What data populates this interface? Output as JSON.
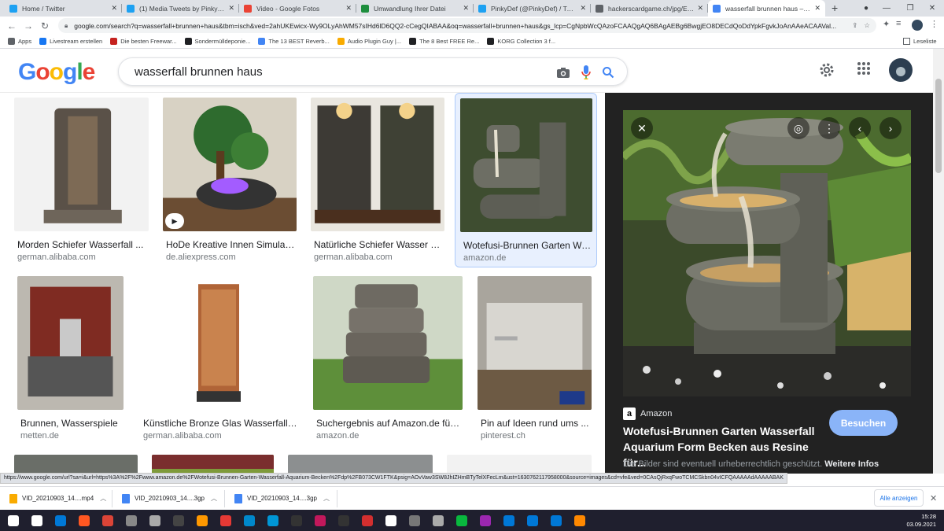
{
  "browser": {
    "tabs": [
      {
        "title": "Home / Twitter",
        "favicon_color": "#1da1f2",
        "active": false
      },
      {
        "title": "(1) Media Tweets by PinkyDef (@",
        "favicon_color": "#1da1f2",
        "active": false
      },
      {
        "title": "Video - Google Fotos",
        "favicon_color": "#ea4335",
        "active": false
      },
      {
        "title": "Umwandlung Ihrer Datei",
        "favicon_color": "#1e8e3e",
        "active": false
      },
      {
        "title": "PinkyDef (@PinkyDef) / Twitter",
        "favicon_color": "#1da1f2",
        "active": false
      },
      {
        "title": "hackerscardgame.ch/jpg/EN/#a",
        "favicon_color": "#5f6368",
        "active": false
      },
      {
        "title": "wasserfall brunnen haus – Goog",
        "favicon_color": "#4285f4",
        "active": true
      }
    ],
    "new_tab_symbol": "+",
    "url": "google.com/search?q=wasserfall+brunnen+haus&tbm=isch&ved=2ahUKEwicx-Wy9OLyAhWM57sIHd6lD6QQ2-cCegQIABAA&oq=wasserfall+brunnen+haus&gs_lcp=CgNpbWcQAzoFCAAQgAQ6BAgAEBg6BwgjEO8DECdQoDdYpkFgvkJoAnAAeACAAVal...",
    "bookmarks": [
      {
        "label": "Apps",
        "color": "#5f6368"
      },
      {
        "label": "Livestream erstellen",
        "color": "#1877f2"
      },
      {
        "label": "Die besten Freewar...",
        "color": "#c5221f"
      },
      {
        "label": "Sondermülldeponie...",
        "color": "#202124"
      },
      {
        "label": "The 13 BEST Reverb...",
        "color": "#4285f4"
      },
      {
        "label": "Audio Plugin Guy |...",
        "color": "#f9ab00"
      },
      {
        "label": "The 8 Best FREE Re...",
        "color": "#202124"
      },
      {
        "label": "KORG Collection 3 f...",
        "color": "#202124"
      }
    ],
    "reading_list": "Leseliste"
  },
  "google": {
    "logo_letters": [
      {
        "ch": "G",
        "color": "#4285f4"
      },
      {
        "ch": "o",
        "color": "#ea4335"
      },
      {
        "ch": "o",
        "color": "#fbbc05"
      },
      {
        "ch": "g",
        "color": "#4285f4"
      },
      {
        "ch": "l",
        "color": "#34a853"
      },
      {
        "ch": "e",
        "color": "#ea4335"
      }
    ],
    "query": "wasserfall brunnen haus"
  },
  "results": [
    {
      "caption": "Morden Schiefer Wasserfall ...",
      "source": "german.alibaba.com",
      "scene": "fountain_dark"
    },
    {
      "caption": "HoDe Kreative Innen Simulati...",
      "source": "de.aliexpress.com",
      "scene": "bonsai",
      "video": true
    },
    {
      "caption": "Natürliche Schiefer Wasser W...",
      "source": "german.alibaba.com",
      "scene": "slate_wall"
    },
    {
      "caption": "Wotefusi-Brunnen Garten Wa...",
      "source": "amazon.de",
      "scene": "bowls",
      "selected": true
    },
    {
      "caption": "Brunnen, Wasserspiele",
      "source": "metten.de",
      "scene": "red_wall"
    },
    {
      "caption": "Künstliche Bronze Glas Wasserfall ...",
      "source": "german.alibaba.com",
      "scene": "bronze"
    },
    {
      "caption": "Suchergebnis auf Amazon.de für: ...",
      "source": "amazon.de",
      "scene": "rock_tower"
    },
    {
      "caption": "Pin auf Ideen rund ums ...",
      "source": "pinterest.ch",
      "scene": "concrete"
    },
    {
      "caption": "",
      "source": "",
      "scene": "partial_stone"
    },
    {
      "caption": "",
      "source": "",
      "scene": "partial_hedge"
    },
    {
      "caption": "",
      "source": "",
      "scene": "partial_grey"
    },
    {
      "caption": "",
      "source": "",
      "scene": "partial_plant"
    }
  ],
  "preview": {
    "source": "Amazon",
    "title": "Wotefusi-Brunnen Garten Wasserfall Aquarium Form Becken aus Resine für...",
    "visit_label": "Besuchen",
    "copyright": "Die Bilder sind eventuell urheberrechtlich geschützt.",
    "more_info": "Weitere Infos"
  },
  "status_url": "https://www.google.com/url?sa=i&url=https%3A%2F%2Fwww.amazon.de%2FWotefusi-Brunnen-Garten-Wasserfall-Aquarium-Becken%2Fdp%2FB073CW1FTK&psig=AOvVaw3SW8JhIZHmBTyTelXFecLm&ust=1630762117958000&source=images&cd=vfe&ved=0CAsQjRxqFwoTCMCSkbn04vICFQAAAAAdAAAAABAK",
  "downloads": [
    {
      "name": "VID_20210903_14....mp4",
      "icon_color": "#f9ab00"
    },
    {
      "name": "VID_20210903_14....3gp",
      "icon_color": "#4285f4"
    },
    {
      "name": "VID_20210903_14....3gp",
      "icon_color": "#4285f4"
    }
  ],
  "show_all": "Alle anzeigen",
  "taskbar": {
    "time": "15:28",
    "date": "03.09.2021",
    "apps": [
      "#ffffff",
      "#ffffff",
      "#0078d7",
      "#ff5722",
      "#db4437",
      "#888888",
      "#aaaaaa",
      "#444444",
      "#ff9800",
      "#e53935",
      "#0088cc",
      "#0096d6",
      "#333333",
      "#c2185b",
      "#333333",
      "#d32f2f",
      "#ffffff",
      "#777777",
      "#aaaaaa",
      "#09b83e",
      "#9c27b0",
      "#0078d7",
      "#0078d7",
      "#0078d7",
      "#ff8800"
    ]
  }
}
